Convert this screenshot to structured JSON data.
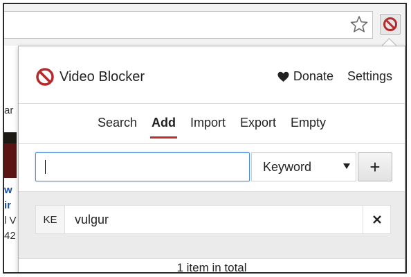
{
  "extension": {
    "title": "Video Blocker",
    "accent_color": "#b52a2a",
    "icon": "block-icon"
  },
  "header": {
    "donate_label": "Donate",
    "settings_label": "Settings"
  },
  "tabs": [
    {
      "label": "Search",
      "active": false
    },
    {
      "label": "Add",
      "active": true
    },
    {
      "label": "Import",
      "active": false
    },
    {
      "label": "Export",
      "active": false
    },
    {
      "label": "Empty",
      "active": false
    }
  ],
  "add_form": {
    "input_value": "",
    "type_selected": "Keyword",
    "add_button_label": "+"
  },
  "items": [
    {
      "type": "KE",
      "value": "vulgur"
    }
  ],
  "footer": {
    "total_text": "1 item in total"
  },
  "page_behind": {
    "fragments": [
      "ar",
      "w",
      "ir",
      "l V",
      "42"
    ]
  }
}
